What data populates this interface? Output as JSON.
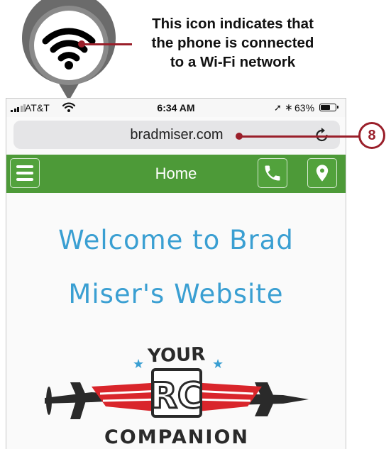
{
  "callout": {
    "wifi_text_lines": [
      "This icon indicates that",
      "the phone is connected",
      "to a Wi-Fi network"
    ],
    "step_number": "8",
    "accent_color": "#9a1f2a"
  },
  "status_bar": {
    "carrier": "AT&T",
    "time": "6:34 AM",
    "battery_percent": "63%",
    "icons": [
      "signal-icon",
      "wifi-icon",
      "location-arrow-icon",
      "bluetooth-icon",
      "battery-icon"
    ]
  },
  "browser": {
    "url": "bradmiser.com",
    "reload_icon": "reload-icon"
  },
  "site": {
    "nav_color": "#4d9a38",
    "nav_title": "Home",
    "welcome_line_1": "Welcome to Brad",
    "welcome_line_2": "Miser's Website",
    "heading_color": "#3a9fd2",
    "logo": {
      "top_text": "YOUR",
      "center_text": "RC",
      "bottom_text": "COMPANION"
    }
  }
}
